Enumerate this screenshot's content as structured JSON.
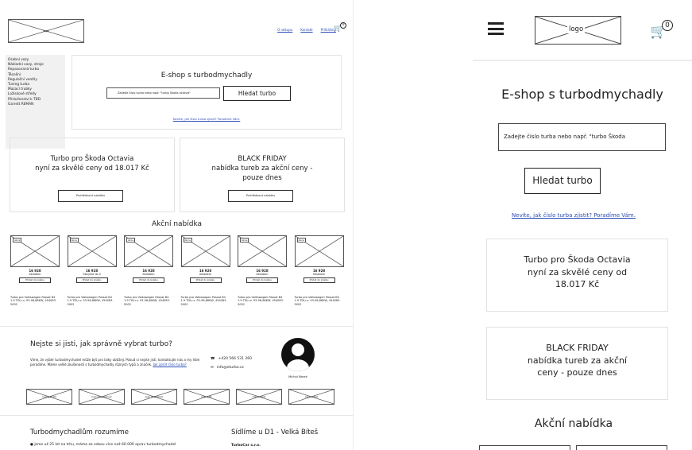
{
  "desktop": {
    "logo": "logo",
    "nav": [
      "O nákupu",
      "Kontakt",
      "Přihlášení"
    ],
    "cart_badge": "0",
    "sidebar": [
      "Osobní vozy",
      "Nákladní vozy, stroje",
      "Repasovaná turba",
      "Těsnění",
      "Regulační ventily",
      "Tuning turba",
      "Mazací trubky",
      "Ložiskové středy",
      "Příslušenství k TBD",
      "Garrett REMAN"
    ],
    "search": {
      "title": "E-shop s turbodmychadly",
      "placeholder": "Zadejte číslo turba nebo např. \"turbo Škoda octavia\"",
      "button": "Hledat turbo",
      "help_link": "Nevíte, jak číslo turba zjistit? Poradíme Vám."
    },
    "promos": [
      {
        "line1": "Turbo pro Škoda Octavia",
        "line2": "nyní za skvělé ceny od 18.017 Kč",
        "button": "Prohlédnout nabídku"
      },
      {
        "line1": "BLACK FRIDAY",
        "line2": "nabídka tureb za akční ceny -",
        "line3": "pouze dnes",
        "button": "Prohlédnout nabídku"
      }
    ],
    "sale_title": "Akční nabídka",
    "products": [
      {
        "tag": "Akce",
        "price": "16 928",
        "stock": "Skladem",
        "button": "Přidat do košíku",
        "desc": "Turbo pro Volkswagen Passat B4 1.9 TDI,r.v. 93-96,66KW, 454083-5002"
      },
      {
        "tag": "Akce",
        "price": "16 928",
        "stock": "Obvykle do 2",
        "button": "Přidat do košíku",
        "desc": "Turbo pro Volkswagen Passat B4 1.9 TDI,r.v. 93-96,66KW, 454083-5002"
      },
      {
        "tag": "Akce",
        "price": "16 928",
        "stock": "Skladem",
        "button": "Přidat do košíku",
        "desc": "Turbo pro Volkswagen Passat B4 1.9 TDI,r.v. 93-96,66KW, 454083-5002"
      },
      {
        "tag": "Akce",
        "price": "16 928",
        "stock": "Skladem",
        "button": "Přidat do košíku",
        "desc": "Turbo pro Volkswagen Passat B4 1.9 TDI,r.v. 93-96,66KW, 454083-5002"
      },
      {
        "tag": "Akce",
        "price": "16 928",
        "stock": "Skladem",
        "button": "Přidat do košíku",
        "desc": "Turbo pro Volkswagen Passat B4 1.9 TDI,r.v. 93-96,66KW, 454083-5002"
      },
      {
        "tag": "Akce",
        "price": "16 928",
        "stock": "Skladem",
        "button": "Přidat do košíku",
        "desc": "Turbo pro Volkswagen Passat B4 1.9 TDI,r.v. 93-96,66KW, 454083-5002"
      }
    ],
    "help": {
      "title": "Nejste si jisti, jak správně vybrat turbo?",
      "text": "Víme, že výběr turbodmychadel může být pro laiky obtížný. Pokud si nejste jisti, kontaktujte nás a my Vám poradíme. Máme velké zkušenosti s turbodmychadly různých typů a značek.",
      "link": "Jak zjistit číslo turba?",
      "phone": "+420 566 531 260",
      "email": "info@eturbo.cz",
      "person": "Michal Marek"
    },
    "brands": [
      "logo garrett",
      "logo borg-warner",
      "logo mitsubishi",
      "logo KKK",
      "logo holset",
      "logo holset"
    ],
    "footer": {
      "left_title": "Turbodmychadlům rozumíme",
      "right_title": "Sídlíme u D1 - Velká Bíteš",
      "bullet": "Jsme už 25 let na trhu, máme za sebou více než 60.000 oprav turbodmychadel",
      "company": "TurboCar s.r.o."
    }
  },
  "mobile": {
    "logo": "logo",
    "cart_badge": "0",
    "title": "E-shop s turbodmychadly",
    "placeholder": "Zadejte číslo turba nebo např. \"turbo Škoda",
    "button": "Hledat turbo",
    "help_link": "Nevíte, jak číslo turba zjistit? Poradíme Vám.",
    "promo1": [
      "Turbo pro Škoda Octavia",
      "nyní za skvělé ceny od",
      "18.017 Kč"
    ],
    "promo2": [
      "BLACK FRIDAY",
      "nabídka tureb za akční",
      "ceny - pouze dnes"
    ],
    "sale_title": "Akční nabídka"
  }
}
